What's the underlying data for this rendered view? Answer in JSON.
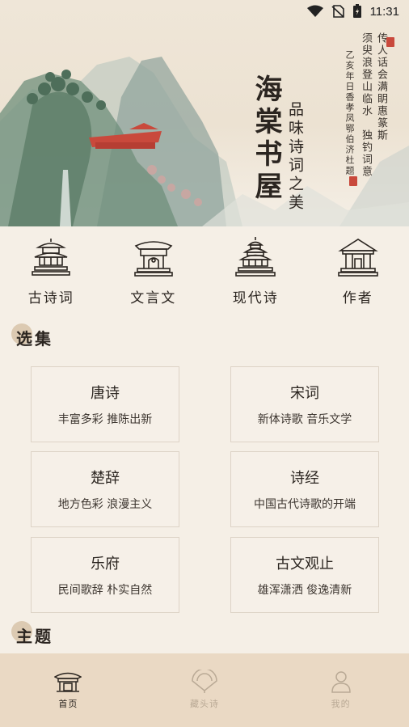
{
  "status_bar": {
    "time": "11:31"
  },
  "banner": {
    "title": "海棠书屋",
    "subtitle": "品味诗词之美",
    "calligraphy": [
      "传人话会满眀惠篆斯",
      "须臾浪登山临水",
      "独钓词意",
      "乙亥年日香孝凤鄂伯济杜题"
    ]
  },
  "categories": [
    {
      "label": "古诗词",
      "icon": "pavilion-icon"
    },
    {
      "label": "文言文",
      "icon": "gate-icon"
    },
    {
      "label": "现代诗",
      "icon": "temple-of-heaven-icon"
    },
    {
      "label": "作者",
      "icon": "hall-icon"
    }
  ],
  "sections": {
    "selection": "选集",
    "theme": "主题"
  },
  "cards": [
    {
      "title": "唐诗",
      "subtitle": "丰富多彩 推陈出新"
    },
    {
      "title": "宋词",
      "subtitle": "新体诗歌 音乐文学"
    },
    {
      "title": "楚辞",
      "subtitle": "地方色彩 浪漫主义"
    },
    {
      "title": "诗经",
      "subtitle": "中国古代诗歌的开端"
    },
    {
      "title": "乐府",
      "subtitle": "民间歌辞 朴实自然"
    },
    {
      "title": "古文观止",
      "subtitle": "雄浑潇洒 俊逸清新"
    }
  ],
  "bottom_nav": [
    {
      "label": "首页",
      "icon": "home-pavilion-icon",
      "active": true
    },
    {
      "label": "藏头诗",
      "icon": "fan-icon",
      "active": false
    },
    {
      "label": "我的",
      "icon": "user-icon",
      "active": false
    }
  ],
  "colors": {
    "background": "#f5efe6",
    "nav_background": "#ead9c4",
    "accent_red": "#c9493c",
    "inactive": "#b9a995"
  }
}
